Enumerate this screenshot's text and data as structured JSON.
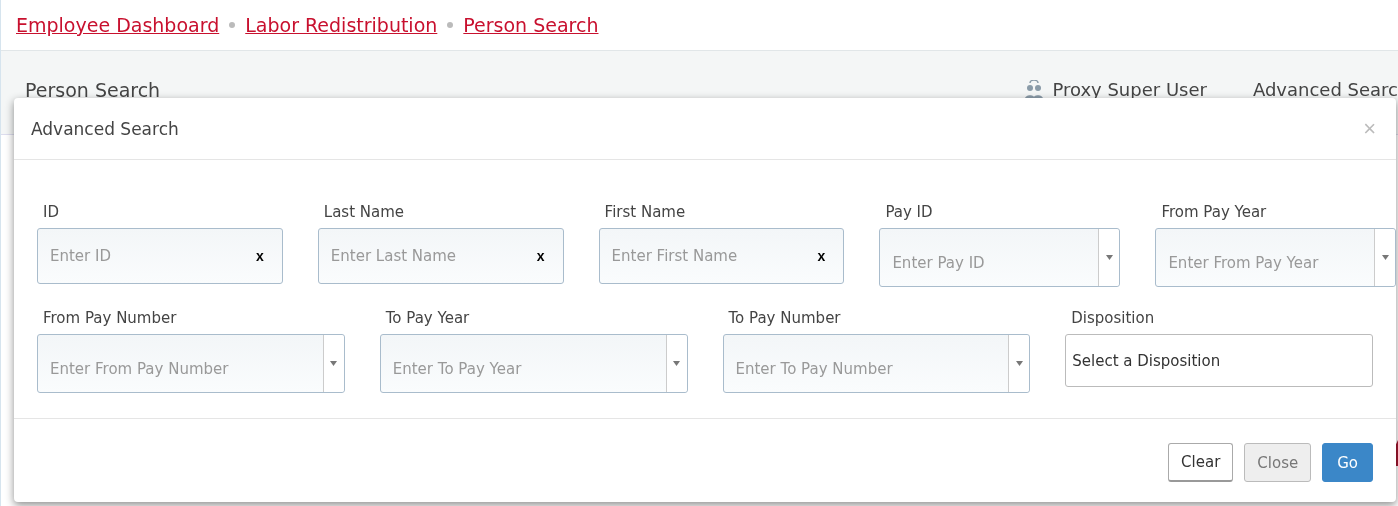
{
  "breadcrumbs": [
    "Employee Dashboard",
    "Labor Redistribution",
    "Person Search"
  ],
  "page_header": {
    "title": "Person Search",
    "actions": [
      {
        "label": "Proxy Super User",
        "kind": "proxy"
      },
      {
        "label": "Advanced Searc",
        "kind": "plain"
      }
    ]
  },
  "dialog": {
    "title": "Advanced Search",
    "close": "×",
    "rows": [
      [
        {
          "label": "ID",
          "kind": "text",
          "placeholder": "Enter ID",
          "clear": "x"
        },
        {
          "label": "Last Name",
          "kind": "text",
          "placeholder": "Enter Last Name",
          "clear": "x"
        },
        {
          "label": "First Name",
          "kind": "text",
          "placeholder": "Enter First Name",
          "clear": "x"
        },
        {
          "label": "Pay ID",
          "kind": "combo",
          "placeholder": "Enter Pay ID"
        },
        {
          "label": "From Pay Year",
          "kind": "combo",
          "placeholder": "Enter From Pay Year"
        }
      ],
      [
        {
          "label": "From Pay Number",
          "kind": "combo",
          "placeholder": "Enter From Pay Number"
        },
        {
          "label": "To Pay Year",
          "kind": "combo",
          "placeholder": "Enter To Pay Year"
        },
        {
          "label": "To Pay Number",
          "kind": "combo",
          "placeholder": "Enter To Pay Number"
        },
        {
          "label": "Disposition",
          "kind": "select",
          "value": "Select a Disposition"
        }
      ]
    ],
    "buttons": [
      {
        "label": "Clear",
        "kind": "default"
      },
      {
        "label": "Close",
        "kind": "muted"
      },
      {
        "label": "Go",
        "kind": "primary"
      }
    ]
  }
}
